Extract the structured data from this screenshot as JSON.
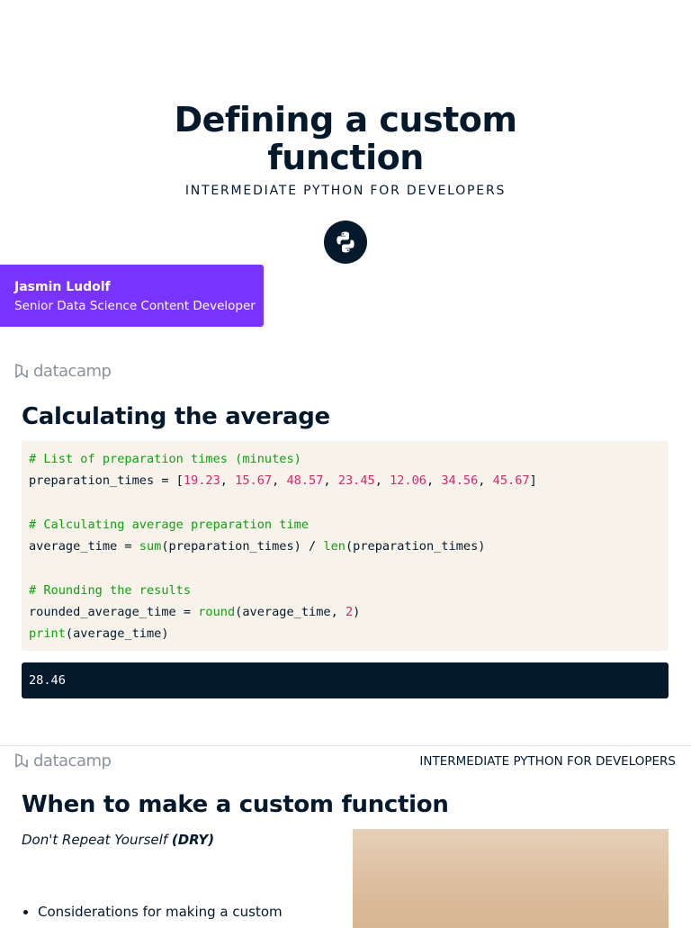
{
  "title_slide": {
    "title_line1": "Defining a custom",
    "title_line2": "function",
    "subtitle": "INTERMEDIATE PYTHON FOR DEVELOPERS",
    "logo_icon": "python-icon",
    "author_name": "Jasmin Ludolf",
    "author_role": "Senior Data Science Content Developer",
    "author_box_color": "#7933ff"
  },
  "brand": {
    "logo_text": "datacamp"
  },
  "slide_average": {
    "heading": "Calculating the average",
    "code": {
      "comment1": "# List of preparation times (minutes)",
      "assign1_prefix": "preparation_times = [",
      "nums": [
        "19.23",
        "15.67",
        "48.57",
        "23.45",
        "12.06",
        "34.56",
        "45.67"
      ],
      "assign1_suffix": "]",
      "comment2": "# Calculating average preparation time",
      "assign2_prefix": "average_time = ",
      "fn_sum": "sum",
      "assign2_mid": "(preparation_times) / ",
      "fn_len": "len",
      "assign2_suffix": "(preparation_times)",
      "comment3": "# Rounding the results",
      "assign3_prefix": "rounded_average_time = ",
      "fn_round": "round",
      "assign3_mid": "(average_time, ",
      "round_digits": "2",
      "assign3_suffix": ")",
      "fn_print": "print",
      "print_args": "(average_time)"
    },
    "output": "28.46"
  },
  "slide_when": {
    "course_label": "INTERMEDIATE PYTHON FOR DEVELOPERS",
    "heading": "When to make a custom function",
    "dry_prefix": "Don't Repeat Yourself ",
    "dry_abbrev": "(DRY)",
    "bullets": [
      "Considerations for making a custom"
    ]
  }
}
